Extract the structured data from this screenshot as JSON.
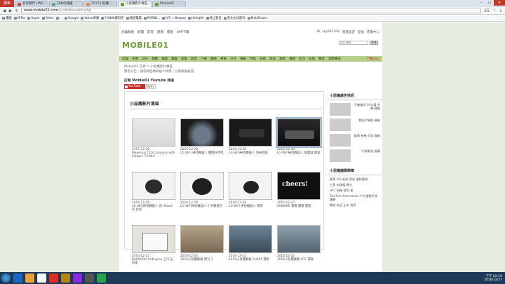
{
  "browser": {
    "logo": "選單",
    "tabs": [
      {
        "label": "合作夥伴 LINE:...",
        "color": "#d44"
      },
      {
        "label": "日本的韓國",
        "color": "#6a8"
      },
      {
        "label": "2017小惡魔...",
        "color": "#e83"
      },
      {
        "label": "小惡魔影片專區 - Mobile01",
        "color": "#6e9a3b",
        "active": true
      },
      {
        "label": "Mobile01",
        "color": "#6e9a3b"
      }
    ],
    "url_host": "www.mobile01.com",
    "url_path": "/youtubevideo.php",
    "zoom": "25"
  },
  "bookmarks": [
    "電腦",
    "MiTac",
    "Apple",
    "Other",
    "...",
    "Google",
    "Yahoo奇摩",
    "FUN08資料夾",
    "瑞昱電腦",
    "PHPBB...",
    "IVT + Browse",
    "HelloJAV",
    "綠上影音",
    "英文文法創作",
    "MobiDeals..."
  ],
  "site": {
    "topnav": [
      "討論群組",
      "新聞",
      "影音",
      "部落",
      "帳號",
      "APP下載"
    ],
    "user_links": [
      "HI, sky901108",
      "帳號設定",
      "登出",
      "客服中心"
    ],
    "logo_text": "MOBILE01",
    "search_placeholder": "自訂搜尋",
    "search_button": "搜尋",
    "mainnav": [
      "討論",
      "手機",
      "GPS",
      "相機",
      "筆電",
      "電腦",
      "家電",
      "影音",
      "汽車",
      "機車",
      "單車",
      "戶外",
      "運動",
      "時尚",
      "居家",
      "旅遊",
      "遊戲",
      "書籍",
      "生活",
      "區域",
      "雜誌",
      "遊戲專區",
      "行動App"
    ],
    "breadcrumb": "Mobile01 首頁 > 小惡魔影片專區",
    "notice": "緊急公告：請勿將密碼與他人共用，以免帳號被盜。",
    "subscribe_label": "訂閱 Mobile01 Youtube 頻道",
    "yt_label": "YouTube",
    "yt_count": "999+"
  },
  "panel": {
    "title": "小惡魔影片專區",
    "videos": [
      {
        "date": "2016-12-28",
        "title": "Mawanus C10 Compare with Fotopro TX-Mini",
        "thumb": "t1"
      },
      {
        "date": "2016-12-28",
        "title": "LG WiFi 掃地機器人 體驗好用嗎",
        "thumb": "t2"
      },
      {
        "date": "2016-12-28",
        "title": "LG WiFi掃地機器人 清掃測試",
        "thumb": "t3"
      },
      {
        "date": "2016-12-28",
        "title": "LG WiFi掃地機器人 吸塵器 開箱",
        "thumb": "t4",
        "active": true
      },
      {
        "date": "2016-12-28",
        "title": "LG WiFi掃地機器人 與 iRobot 的 比較",
        "thumb": "t5"
      },
      {
        "date": "2016-12-28",
        "title": "LG WiFi掃地機器人 2 手機遙控",
        "thumb": "t6"
      },
      {
        "date": "2016-12-28",
        "title": "LG WiFi 掃地機器人 實測",
        "thumb": "t7"
      },
      {
        "date": "2016-12-22",
        "title": "SUNMAR 耳機 體驗 開箱",
        "thumb": "t8",
        "overlay": "cheers!"
      },
      {
        "date": "2016-12-22",
        "title": "BALMUDA AirEngine 上市 記者會",
        "thumb": "t9"
      },
      {
        "date": "2016-12-22",
        "title": "2016小惡魔聚餐 實況 1",
        "thumb": "t10"
      },
      {
        "date": "2016-12-22",
        "title": "2016小惡魔聚餐 SHARP 贊助",
        "thumb": "t11"
      },
      {
        "date": "2016-12-22",
        "title": "2016小惡魔聚餐 HTC 贊助",
        "thumb": "t12"
      }
    ]
  },
  "sidebar": {
    "ads_title": "小惡魔廣告快訊",
    "ads": [
      "手機電池 30分鐘 充飽 開箱",
      "雙面手機殼 開箱",
      "華碩 新機 首發 開箱",
      "行動電源 推薦"
    ],
    "news_title": "小惡魔議題精華",
    "news": [
      "蘋果 iOS 新版 更新 重點整理",
      "三星 新旗艦 曝光",
      "HTC 新機 發表 會",
      "TomTom Adventurer 戶外運動手錶 體驗",
      "電視 新品 上市 資訊"
    ]
  },
  "taskbar": {
    "apps": [
      "#1b66c9",
      "#e6a23c",
      "#f5f5f5",
      "#d93025",
      "#b8860b",
      "#8a2be2",
      "#555",
      "#2aa14e"
    ],
    "time": "下午 02:10",
    "date": "2016/12/27"
  }
}
